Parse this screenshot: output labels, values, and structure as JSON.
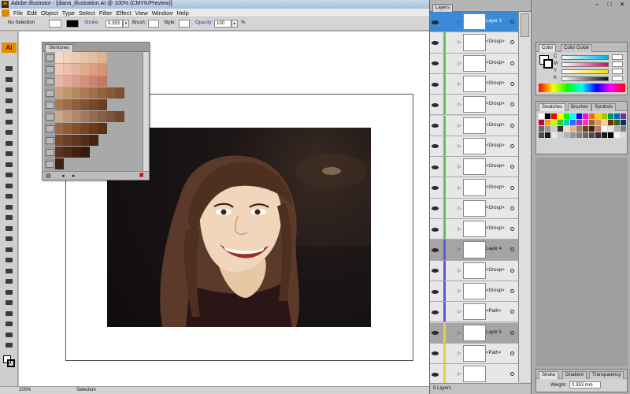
{
  "window": {
    "title": "Adobe Illustrator - [diana_illustration.AI @ 100% (CMYK/Preview)]"
  },
  "menu": [
    "File",
    "Edit",
    "Object",
    "Type",
    "Select",
    "Filter",
    "Effect",
    "View",
    "Window",
    "Help"
  ],
  "control_bar": {
    "selection": "No Selection",
    "stroke_label": "Stroke:",
    "stroke_value": "0.353",
    "brush_label": "Brush:",
    "style_label": "Style:",
    "opacity_label": "Opacity:",
    "opacity_value": "100",
    "percent": "%"
  },
  "tools": {
    "logo": "Ai"
  },
  "status_bar": {
    "zoom": "100%",
    "tool": "Selection"
  },
  "skintones_panel": {
    "tab": "Skintones",
    "rows": [
      [
        "#f2d9c9",
        "#f0d2bd",
        "#eccbb2",
        "#e9c3a8",
        "#e5bc9d",
        "#e0b491"
      ],
      [
        "#efc9b8",
        "#ebbfa9",
        "#e6b49c",
        "#e0aa8e",
        "#d9a081",
        "#d39775"
      ],
      [
        "#e9b7a8",
        "#e3a998",
        "#dc9c8a",
        "#d4907c",
        "#cc8470",
        "#c47965"
      ],
      [
        "#c9a27a",
        "#c0946b",
        "#b6875f",
        "#ac7a53",
        "#a06e48",
        "#94633f",
        "#8a5a38",
        "#7e5032"
      ],
      [
        "#a87a52",
        "#9b6c45",
        "#8f5f3a",
        "#83532f",
        "#774827",
        "#6b3e20"
      ],
      [
        "#c7a88a",
        "#bb997a",
        "#ae896a",
        "#a07a5c",
        "#946c4f",
        "#875f44",
        "#7b5439",
        "#6f4a31"
      ],
      [
        "#a0683f",
        "#925a33",
        "#844e2a",
        "#774322",
        "#6a391b",
        "#5d3016"
      ],
      [
        "#7a4a2c",
        "#6c3f24",
        "#5f351d",
        "#522c17",
        "#462412"
      ],
      [
        "#5a3420",
        "#4d2b19",
        "#402213",
        "#341b0e"
      ],
      [
        "#3e2414"
      ]
    ]
  },
  "layers_panel": {
    "tab": "Layers",
    "rows": [
      {
        "name": "Layer 3",
        "type": "layer",
        "selected": true,
        "color": "#3a8ad8"
      },
      {
        "name": "<Group>",
        "type": "group",
        "color": "#5fbf5f"
      },
      {
        "name": "<Group>",
        "type": "group",
        "color": "#5fbf5f"
      },
      {
        "name": "<Group>",
        "type": "group",
        "color": "#5fbf5f"
      },
      {
        "name": "<Group>",
        "type": "group",
        "color": "#5fbf5f"
      },
      {
        "name": "<Group>",
        "type": "group",
        "color": "#5fbf5f"
      },
      {
        "name": "<Group>",
        "type": "group",
        "color": "#5fbf5f"
      },
      {
        "name": "<Group>",
        "type": "group",
        "color": "#5fbf5f"
      },
      {
        "name": "<Group>",
        "type": "group",
        "color": "#5fbf5f"
      },
      {
        "name": "<Group>",
        "type": "group",
        "color": "#5fbf5f"
      },
      {
        "name": "<Group>",
        "type": "group",
        "color": "#5fbf5f"
      },
      {
        "name": "Layer 4",
        "type": "layer",
        "color": "#5a5ad8"
      },
      {
        "name": "<Group>",
        "type": "group",
        "color": "#5a5ad8"
      },
      {
        "name": "<Group>",
        "type": "group",
        "color": "#5a5ad8"
      },
      {
        "name": "<Path>",
        "type": "group",
        "color": "#5a5ad8"
      },
      {
        "name": "Layer 5",
        "type": "layer",
        "color": "#e2d24a"
      },
      {
        "name": "<Path>",
        "type": "group",
        "color": "#e2d24a"
      },
      {
        "name": "",
        "type": "group",
        "color": "#e2d24a"
      }
    ],
    "footer": "5 Layers"
  },
  "color_panel": {
    "tabs": [
      "Color",
      "Color Guide"
    ],
    "channels": [
      {
        "key": "C",
        "color": "#00aee0"
      },
      {
        "key": "M",
        "color": "#e0007a"
      },
      {
        "key": "Y",
        "color": "#f0e000"
      },
      {
        "key": "K",
        "color": "#111111"
      }
    ]
  },
  "swatches_panel": {
    "tabs": [
      "Swatches",
      "Brushes",
      "Symbols"
    ],
    "colors": [
      "#ffffff",
      "#000000",
      "#ff0000",
      "#ffff00",
      "#00ff00",
      "#00ffff",
      "#0000ff",
      "#ff00ff",
      "#ff6600",
      "#ffcc00",
      "#99cc00",
      "#009966",
      "#0066cc",
      "#663399",
      "#cc0033",
      "#ff9900",
      "#ccff00",
      "#33cc33",
      "#00cccc",
      "#3366ff",
      "#9933cc",
      "#ff3399",
      "#996633",
      "#cc9966",
      "#ffcc99",
      "#663300",
      "#336600",
      "#003366",
      "#666666",
      "#999999",
      "#cccccc",
      "#333333",
      "#f2d9c9",
      "#e0b491",
      "#ac7a53",
      "#6b3e20",
      "#3e2414",
      "#c47965",
      "#ffffff",
      "#e6e6e6",
      "#b3b3b3",
      "#808080",
      "#4d4d4d",
      "#1a1a1a",
      "#e6e6e6",
      "#cccccc",
      "#b3b3b3",
      "#999999",
      "#808080",
      "#666666",
      "#4d4d4d",
      "#333333",
      "#1a1a1a",
      "#000000",
      "#f5f5f5",
      "#dddddd"
    ]
  },
  "stroke_panel": {
    "tabs": [
      "Stroke",
      "Gradient",
      "Transparency"
    ],
    "weight_label": "Weight:",
    "weight_value": "0.353 mm"
  }
}
